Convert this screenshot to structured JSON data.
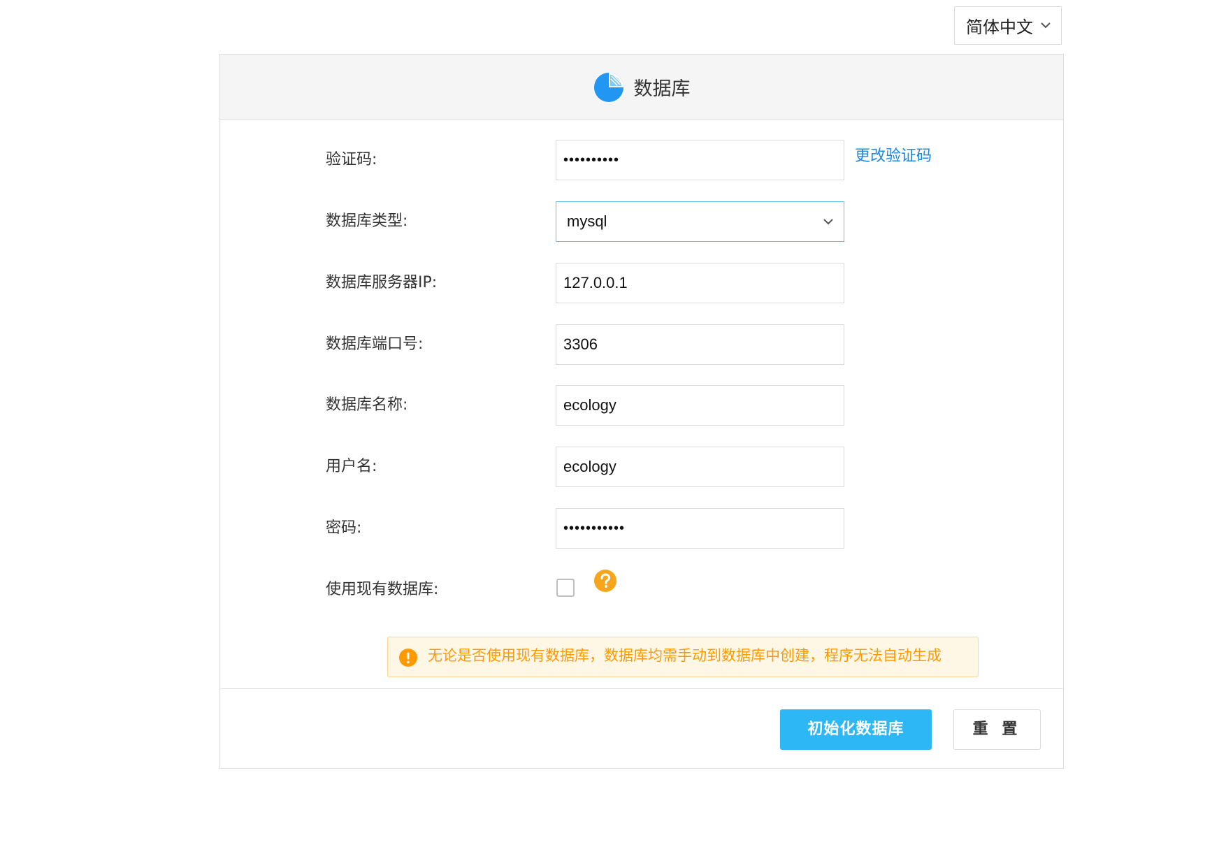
{
  "language_select": {
    "value": "简体中文"
  },
  "panel": {
    "title": "数据库",
    "logo_color": "#2196f3"
  },
  "form": {
    "captcha": {
      "label": "验证码:",
      "value": "••••••••••",
      "change_link": "更改验证码"
    },
    "db_type": {
      "label": "数据库类型:",
      "value": "mysql"
    },
    "db_host": {
      "label": "数据库服务器IP:",
      "value": "127.0.0.1"
    },
    "db_port": {
      "label": "数据库端口号:",
      "value": "3306"
    },
    "db_name": {
      "label": "数据库名称:",
      "value": "ecology"
    },
    "username": {
      "label": "用户名:",
      "value": "ecology"
    },
    "password": {
      "label": "密码:",
      "value": "•••••••••••"
    },
    "use_existing": {
      "label": "使用现有数据库:",
      "checked": false
    }
  },
  "warning": {
    "message": "无论是否使用现有数据库，数据库均需手动到数据库中创建，程序无法自动生成",
    "color": "#ff9900"
  },
  "buttons": {
    "init_label": "初始化数据库",
    "reset_label": "重 置",
    "primary_color": "#2db7f5"
  }
}
